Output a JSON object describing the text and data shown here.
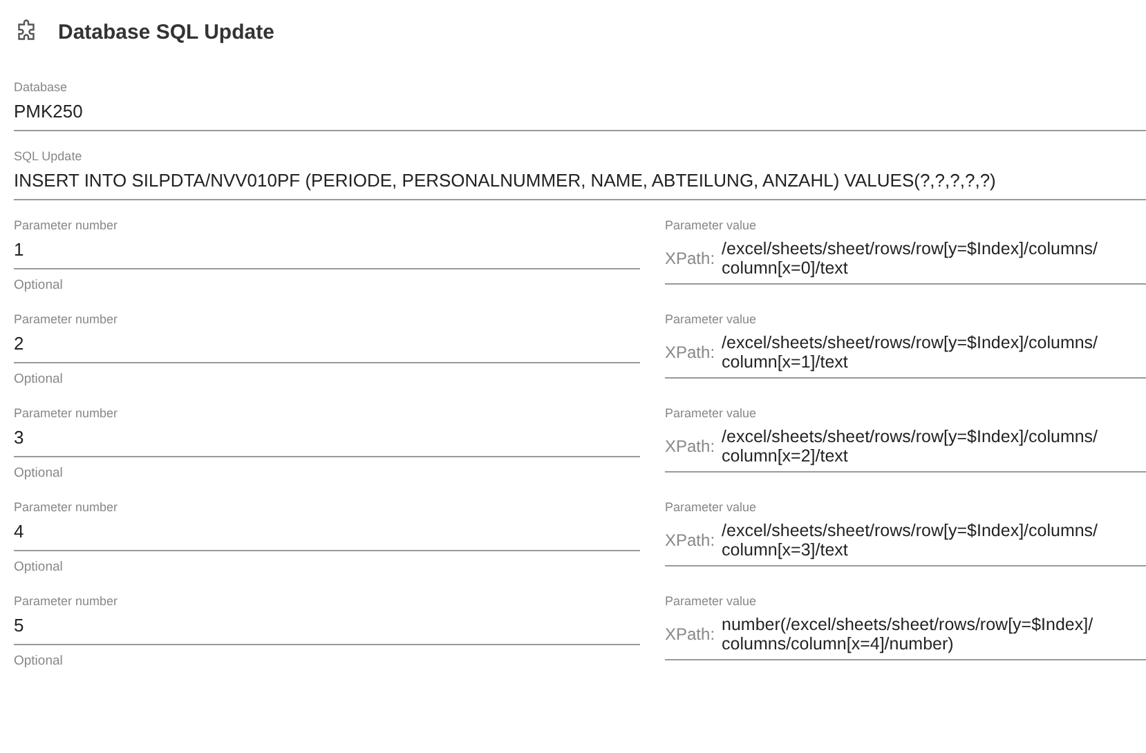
{
  "title": "Database SQL Update",
  "database": {
    "label": "Database",
    "value": "PMK250"
  },
  "sql_update": {
    "label": "SQL Update",
    "value": "INSERT INTO SILPDTA/NVV010PF (PERIODE, PERSONALNUMMER, NAME, ABTEILUNG, ANZAHL) VALUES(?,?,?,?,?)"
  },
  "parameters": [
    {
      "number_label": "Parameter number",
      "number": "1",
      "hint": "Optional",
      "value_label": "Parameter value",
      "prefix": "XPath:",
      "value": "/excel/sheets/sheet/rows/row[y=$Index]/columns/ column[x=0]/text"
    },
    {
      "number_label": "Parameter number",
      "number": "2",
      "hint": "Optional",
      "value_label": "Parameter value",
      "prefix": "XPath:",
      "value": "/excel/sheets/sheet/rows/row[y=$Index]/columns/ column[x=1]/text"
    },
    {
      "number_label": "Parameter number",
      "number": "3",
      "hint": "Optional",
      "value_label": "Parameter value",
      "prefix": "XPath:",
      "value": "/excel/sheets/sheet/rows/row[y=$Index]/columns/ column[x=2]/text"
    },
    {
      "number_label": "Parameter number",
      "number": "4",
      "hint": "Optional",
      "value_label": "Parameter value",
      "prefix": "XPath:",
      "value": "/excel/sheets/sheet/rows/row[y=$Index]/columns/ column[x=3]/text"
    },
    {
      "number_label": "Parameter number",
      "number": "5",
      "hint": "Optional",
      "value_label": "Parameter value",
      "prefix": "XPath:",
      "value": "number(/excel/sheets/sheet/rows/row[y=$Index]/ columns/column[x=4]/number)"
    }
  ]
}
